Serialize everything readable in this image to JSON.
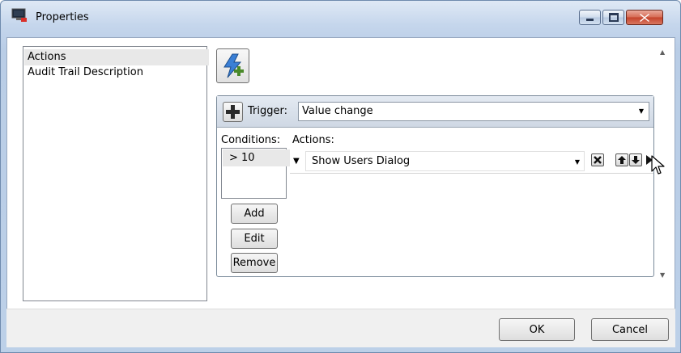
{
  "window": {
    "title": "Properties",
    "accent": "#c4422b"
  },
  "sidebar": {
    "items": [
      {
        "label": "Actions",
        "selected": true
      },
      {
        "label": "Audit Trail Description",
        "selected": false
      }
    ]
  },
  "trigger": {
    "label": "Trigger:",
    "value": "Value change"
  },
  "conditions": {
    "label": "Conditions:",
    "items": [
      "> 10"
    ],
    "buttons": {
      "add": "Add",
      "edit": "Edit",
      "remove": "Remove"
    }
  },
  "actions": {
    "label": "Actions:",
    "items": [
      {
        "value": "Show Users Dialog"
      }
    ]
  },
  "footer": {
    "ok": "OK",
    "cancel": "Cancel"
  },
  "icons": {
    "app": "app-monitor-icon",
    "add_trigger": "lightning-plus-icon",
    "add": "plus-icon",
    "delete": "x-icon",
    "up": "arrow-up-icon",
    "down": "arrow-down-icon",
    "cursor": "mouse-pointer-icon"
  }
}
